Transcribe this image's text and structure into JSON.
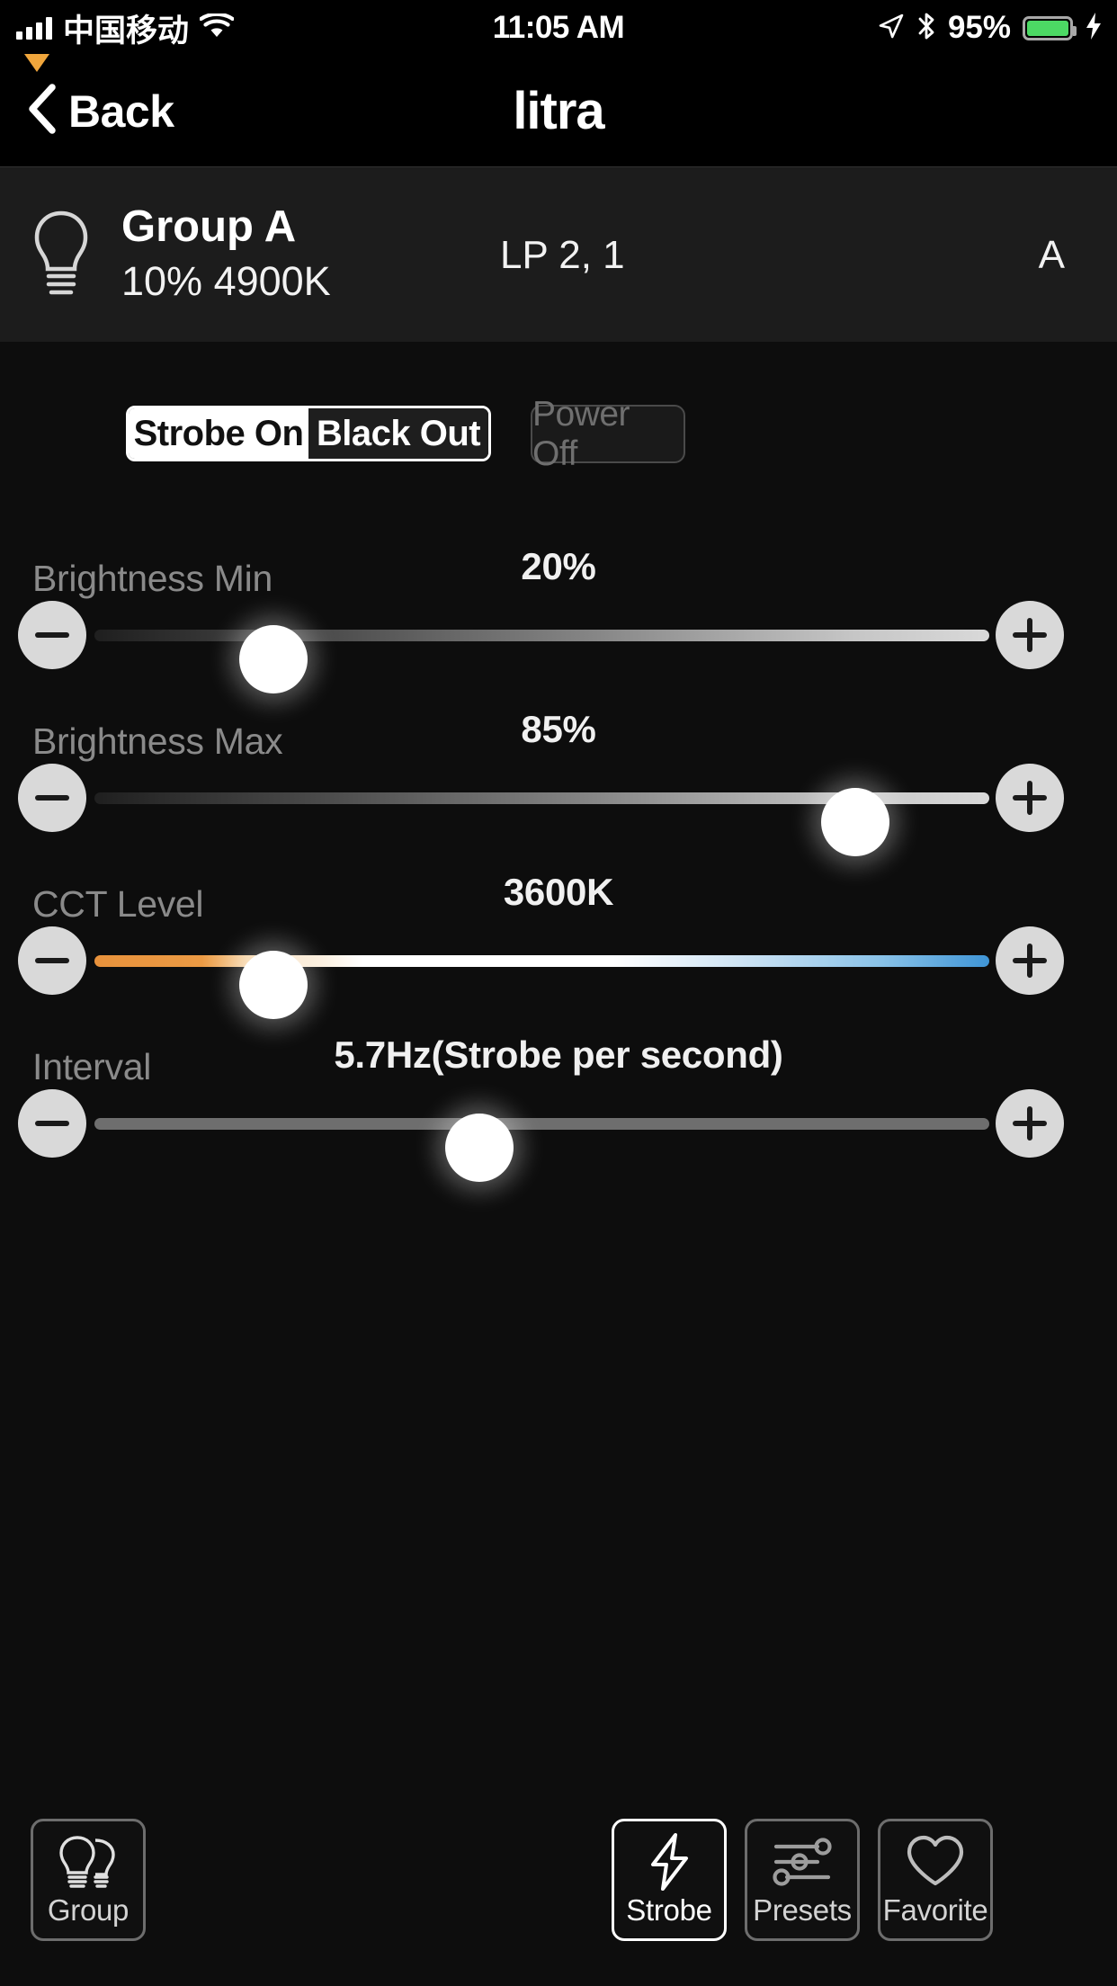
{
  "status_bar": {
    "carrier": "中国移动",
    "time": "11:05 AM",
    "battery_percent": "95%",
    "icons": [
      "signal-bars-icon",
      "wifi-icon",
      "location-arrow-icon",
      "bluetooth-icon",
      "battery-icon",
      "charging-bolt-icon"
    ],
    "battery_color": "#4cd964"
  },
  "nav": {
    "back_label": "Back",
    "logo_text": "litra",
    "logo_accent_color": "#f0a63c"
  },
  "device_info": {
    "name": "Group A",
    "state": "10% 4900K",
    "lamps": "LP 2, 1",
    "channel": "A"
  },
  "controls": {
    "segmented": {
      "options": [
        "Strobe On",
        "Black Out"
      ],
      "selected_index": 0
    },
    "power_off_label": "Power Off"
  },
  "sliders": [
    {
      "label": "Brightness Min",
      "value": "20%",
      "percent": 20,
      "track": "brightness-gradient"
    },
    {
      "label": "Brightness Max",
      "value": "85%",
      "percent": 85,
      "track": "brightness-gradient"
    },
    {
      "label": "CCT Level",
      "value": "3600K",
      "percent": 20,
      "track": "cct-gradient"
    },
    {
      "label": "Interval",
      "value": "5.7Hz(Strobe per second)",
      "percent": 43,
      "track": "plain-gray"
    }
  ],
  "toolbar": [
    {
      "label": "Group",
      "icon": "two-bulbs-icon",
      "active": false
    },
    {
      "label": "Strobe",
      "icon": "lightning-bolt-icon",
      "active": true
    },
    {
      "label": "Presets",
      "icon": "sliders-icon",
      "active": false
    },
    {
      "label": "Favorite",
      "icon": "heart-icon",
      "active": false
    }
  ]
}
